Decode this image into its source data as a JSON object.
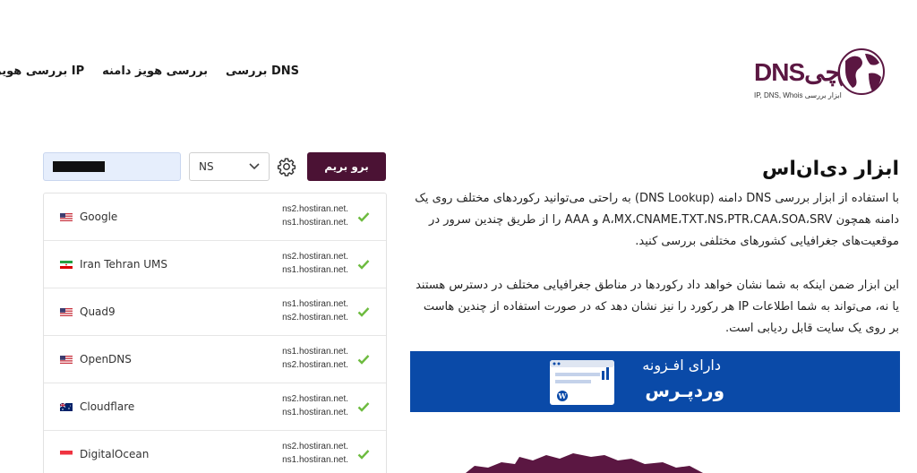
{
  "nav": {
    "items": [
      "بررسی DNS",
      "بررسی هویز دامنه",
      "بررسی هویز IP"
    ]
  },
  "logo": {
    "text": "DNSچی",
    "subtitle": "IP, DNS, Whois  ابزار بررسی"
  },
  "form": {
    "domain_value": "",
    "record_type": "NS",
    "submit_label": "برو بریم"
  },
  "servers": [
    {
      "name": "Google",
      "flag": "us",
      "ns": [
        "ns2.hostiran.net.",
        "ns1.hostiran.net."
      ]
    },
    {
      "name": "Iran Tehran UMS",
      "flag": "ir",
      "ns": [
        "ns2.hostiran.net.",
        "ns1.hostiran.net."
      ]
    },
    {
      "name": "Quad9",
      "flag": "us",
      "ns": [
        "ns1.hostiran.net.",
        "ns2.hostiran.net."
      ]
    },
    {
      "name": "OpenDNS",
      "flag": "us",
      "ns": [
        "ns1.hostiran.net.",
        "ns2.hostiran.net."
      ]
    },
    {
      "name": "Cloudflare",
      "flag": "au",
      "ns": [
        "ns2.hostiran.net.",
        "ns1.hostiran.net."
      ]
    },
    {
      "name": "DigitalOcean",
      "flag": "sg",
      "ns": [
        "ns2.hostiran.net.",
        "ns1.hostiran.net."
      ]
    }
  ],
  "content": {
    "title": "ابزار دی‌ان‌اس",
    "paragraph1": "با استفاده از ابزار بررسی DNS دامنه (DNS Lookup) به راحتی می‌توانید رکوردهای مختلف روی یک دامنه همچون A،MX،CNAME،TXT،NS،PTR،CAA،SOA،SRV و AAA را از طریق چندین سرور در موقعیت‌های جغرافیایی کشورهای مختلفی بررسی کنید.",
    "paragraph2": "این ابزار ضمن اینکه به شما نشان خواهد داد رکوردها در مناطق جغرافیایی مختلف در دسترس هستند یا نه، می‌تواند به شما اطلاعات IP هر رکورد را نیز نشان دهد که در صورت استفاده از چندین هاست بر روی یک سایت قابل ردیابی است."
  },
  "banner": {
    "line1": "دارای افـزونه",
    "line2": "وردپـرس"
  },
  "colors": {
    "brand": "#4b1234",
    "banner": "#0a4aa8",
    "check": "#6dbb3f"
  }
}
